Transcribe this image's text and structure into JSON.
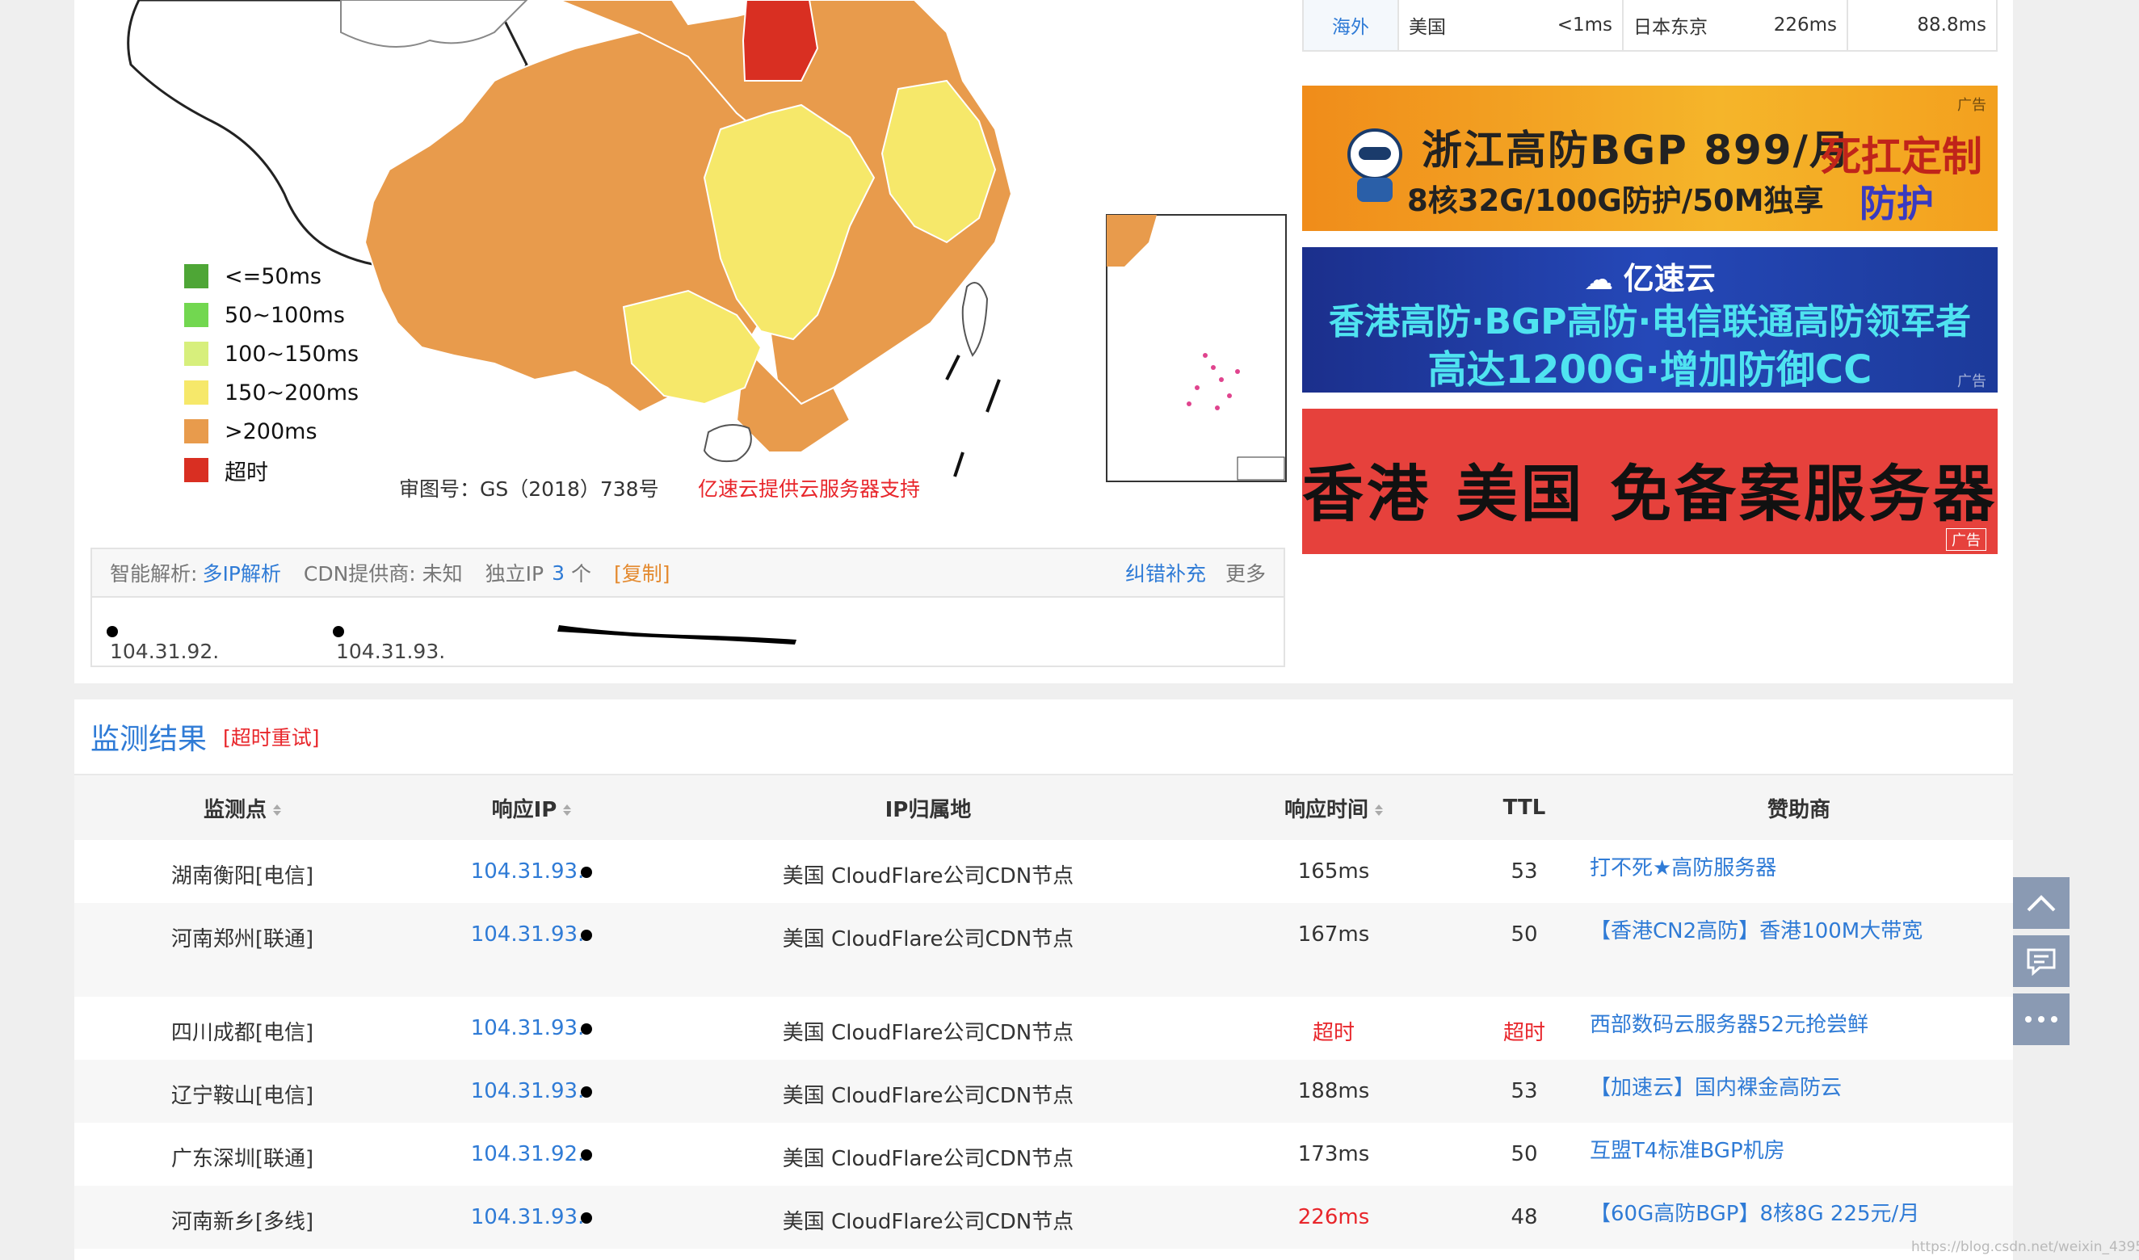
{
  "map": {
    "legend": [
      {
        "label": "<=50ms",
        "color": "#4ea636"
      },
      {
        "label": "50~100ms",
        "color": "#72d750"
      },
      {
        "label": "100~150ms",
        "color": "#d7ef7c"
      },
      {
        "label": "150~200ms",
        "color": "#f6e86a"
      },
      {
        "label": ">200ms",
        "color": "#e89b4c"
      },
      {
        "label": "超时",
        "color": "#d92f22"
      }
    ],
    "approval": "审图号：GS（2018）738号",
    "sponsor_text": "亿速云提供云服务器支持"
  },
  "overseas": {
    "tab": "海外",
    "region": "美国",
    "region_time": "<1ms",
    "city": "日本东京",
    "city_time": "226ms",
    "avg_time": "88.8ms"
  },
  "ads": {
    "ad1": {
      "line1": "浙江高防BGP 899/月",
      "line2": "8核32G/100G防护/50M独享",
      "side1": "死扛定制",
      "side2": "防护",
      "tag": "广告"
    },
    "ad2": {
      "brand": "亿速云",
      "line1": "香港高防·BGP高防·电信联通高防领军者",
      "line2": "高达1200G·增加防御CC",
      "tag": "广告"
    },
    "ad3": {
      "line1": "香港 美国 免备案服务器",
      "tag": "广告"
    }
  },
  "ip_info": {
    "smart_label": "智能解析:",
    "smart_value": "多IP解析",
    "cdn_label": "CDN提供商: 未知",
    "ip_label": "独立IP",
    "ip_count": "3",
    "ip_unit": "个",
    "copy_label": "[复制]",
    "report_label": "纠错补充",
    "more_label": "更多",
    "ips": [
      "104.31.92.",
      "104.31.93."
    ]
  },
  "monitor": {
    "title": "监测结果",
    "retry": "[超时重试]",
    "headers": [
      "监测点",
      "响应IP",
      "IP归属地",
      "响应时间",
      "TTL",
      "赞助商"
    ],
    "rows": [
      {
        "point": "湖南衡阳[电信]",
        "ip": "104.31.93.",
        "loc": "美国 CloudFlare公司CDN节点",
        "time": "165ms",
        "ttl": "53",
        "sponsor": "打不死★高防服务器"
      },
      {
        "point": "河南郑州[联通]",
        "ip": "104.31.93.",
        "loc": "美国 CloudFlare公司CDN节点",
        "time": "167ms",
        "ttl": "50",
        "sponsor": "【香港CN2高防】香港100M大带宽"
      },
      {
        "point": "四川成都[电信]",
        "ip": "104.31.93.",
        "loc": "美国 CloudFlare公司CDN节点",
        "time": "超时",
        "ttl": "超时",
        "sponsor": "西部数码云服务器52元抢尝鲜"
      },
      {
        "point": "辽宁鞍山[电信]",
        "ip": "104.31.93.",
        "loc": "美国 CloudFlare公司CDN节点",
        "time": "188ms",
        "ttl": "53",
        "sponsor": "【加速云】国内裸金高防云"
      },
      {
        "point": "广东深圳[联通]",
        "ip": "104.31.92.",
        "loc": "美国 CloudFlare公司CDN节点",
        "time": "173ms",
        "ttl": "50",
        "sponsor": "互盟T4标准BGP机房"
      },
      {
        "point": "河南新乡[多线]",
        "ip": "104.31.93.",
        "loc": "美国 CloudFlare公司CDN节点",
        "time": "226ms",
        "ttl": "48",
        "sponsor": "【60G高防BGP】8核8G 225元/月"
      }
    ]
  },
  "watermark": "https://blog.csdn.net/weixin_4395..."
}
